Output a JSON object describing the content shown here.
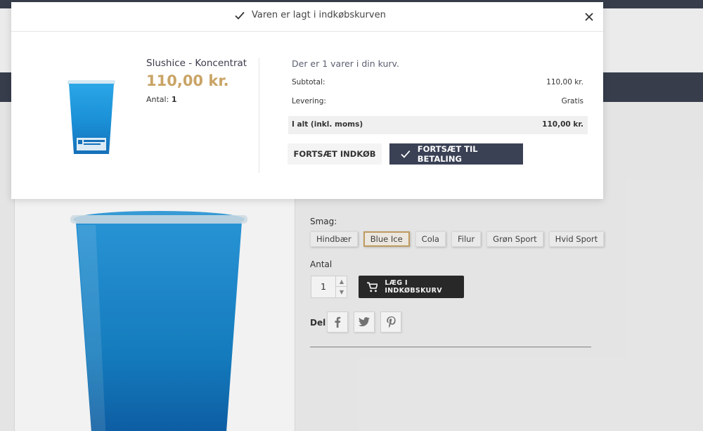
{
  "modal": {
    "title": "Varen er lagt i indkøbskurven",
    "product": {
      "name": "Slushice - Koncentrat",
      "price": "110,00 kr.",
      "qty_label": "Antal:",
      "qty_value": "1"
    },
    "cart": {
      "count_text": "Der er 1 varer i din kurv.",
      "subtotal_label": "Subtotal:",
      "subtotal_value": "110,00 kr.",
      "shipping_label": "Levering:",
      "shipping_value": "Gratis",
      "total_label": "I alt (inkl. moms)",
      "total_value": "110,00 kr."
    },
    "buttons": {
      "continue": "FORTSÆT INDKØB",
      "checkout": "FORTSÆT TIL BETALING"
    }
  },
  "product_page": {
    "smag_label": "Smag:",
    "variants": [
      "Hindbær",
      "Blue Ice",
      "Cola",
      "Filur",
      "Grøn Sport",
      "Hvid Sport"
    ],
    "selected_variant": "Blue Ice",
    "antal_label": "Antal",
    "quantity": "1",
    "add_to_cart": "LÆG I INDKØBSKURV",
    "share_label": "Del"
  },
  "icons": [
    "check-icon",
    "close-icon",
    "cart-icon",
    "facebook-icon",
    "twitter-icon",
    "pinterest-icon",
    "chevron-up-icon",
    "chevron-down-icon"
  ],
  "colors": {
    "accent_gold": "#c9a466",
    "dark_button": "#3a4155",
    "cup_blue": "#1e8fd0"
  }
}
